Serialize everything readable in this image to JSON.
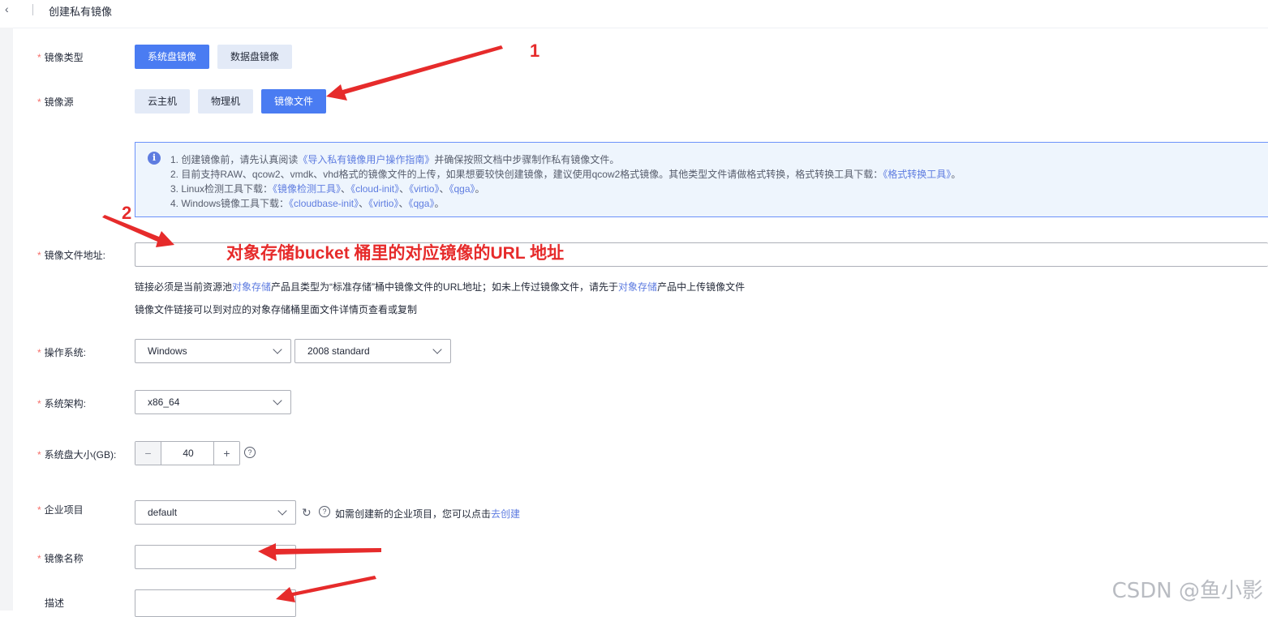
{
  "header": {
    "title": "创建私有镜像"
  },
  "form": {
    "image_type": {
      "label": "镜像类型",
      "options": [
        "系统盘镜像",
        "数据盘镜像"
      ],
      "selected": "系统盘镜像"
    },
    "image_source": {
      "label": "镜像源",
      "options": [
        "云主机",
        "物理机",
        "镜像文件"
      ],
      "selected": "镜像文件"
    },
    "notice": {
      "line1_pre": "1. 创建镜像前，请先认真阅读",
      "line1_link": "《导入私有镜像用户操作指南》",
      "line1_post": "并确保按照文档中步骤制作私有镜像文件。",
      "line2_pre": "2. 目前支持RAW、qcow2、vmdk、vhd格式的镜像文件的上传，如果想要较快创建镜像，建议使用qcow2格式镜像。其他类型文件请做格式转换，格式转换工具下载：",
      "line2_link": "《格式转换工具》",
      "line2_post": "。",
      "line3_pre": "3. Linux检测工具下载：",
      "line3_links": [
        "《镜像检测工具》",
        "《cloud-init》",
        "《virtio》",
        "《qga》"
      ],
      "line4_pre": "4. Windows镜像工具下载：",
      "line4_links": [
        "《cloudbase-init》",
        "《virtio》",
        "《qga》"
      ],
      "sep": "、",
      "end": "。"
    },
    "image_url": {
      "label": "镜像文件地址:",
      "value": "",
      "hint1_a": "链接必须是当前资源池",
      "hint1_link1": "对象存储",
      "hint1_b": "产品且类型为“标准存储”桶中镜像文件的URL地址；如未上传过镜像文件，请先于",
      "hint1_link2": "对象存储",
      "hint1_c": "产品中上传镜像文件",
      "hint2": "镜像文件链接可以到对应的对象存储桶里面文件详情页查看或复制"
    },
    "os": {
      "label": "操作系统:",
      "type": "Windows",
      "version": "2008 standard"
    },
    "arch": {
      "label": "系统架构:",
      "value": "x86_64"
    },
    "disk_size": {
      "label": "系统盘大小(GB):",
      "value": "40",
      "minus": "−",
      "plus": "+"
    },
    "project": {
      "label": "企业项目",
      "value": "default",
      "hint": "如需创建新的企业项目，您可以点击",
      "link": "去创建"
    },
    "image_name": {
      "label": "镜像名称",
      "value": ""
    },
    "description": {
      "label": "描述",
      "value": ""
    }
  },
  "annotations": {
    "num1": "1",
    "num2": "2",
    "url_note": "对象存储bucket 桶里的对应镜像的URL 地址",
    "color": "#e62b2b"
  },
  "watermark": "CSDN @鱼小影",
  "colors": {
    "primary": "#4a7cf2",
    "link": "#5e7ce0",
    "required": "#f66f6a"
  }
}
